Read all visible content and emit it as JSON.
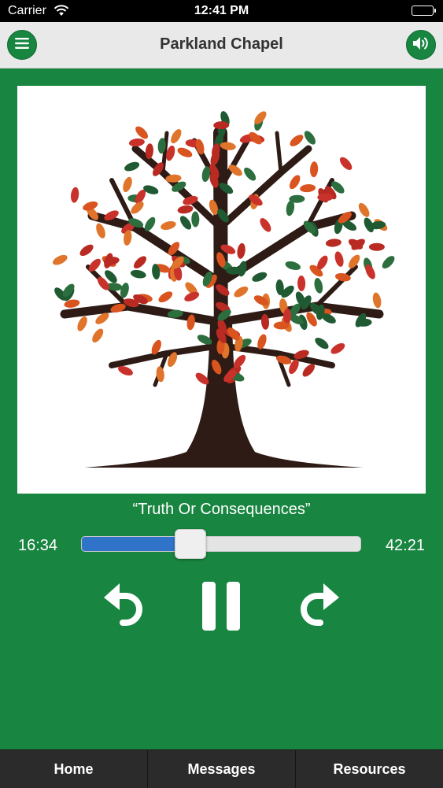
{
  "status_bar": {
    "carrier": "Carrier",
    "time": "12:41 PM",
    "wifi_icon": "wifi-icon",
    "battery_icon": "battery-icon"
  },
  "nav": {
    "title": "Parkland Chapel",
    "menu_icon": "hamburger-menu-icon",
    "volume_icon": "speaker-volume-icon"
  },
  "player": {
    "track_title": "“Truth Or Consequences”",
    "elapsed": "16:34",
    "total": "42:21",
    "progress_fraction": 0.391,
    "rewind_icon": "rewind-icon",
    "pause_icon": "pause-icon",
    "forward_icon": "forward-icon"
  },
  "tabs": [
    {
      "label": "Home"
    },
    {
      "label": "Messages"
    },
    {
      "label": "Resources"
    }
  ],
  "colors": {
    "brand_green": "#188540",
    "progress_blue": "#2f74c8",
    "nav_gray": "#e9e9e9",
    "tab_bar": "#2b2b2b"
  }
}
